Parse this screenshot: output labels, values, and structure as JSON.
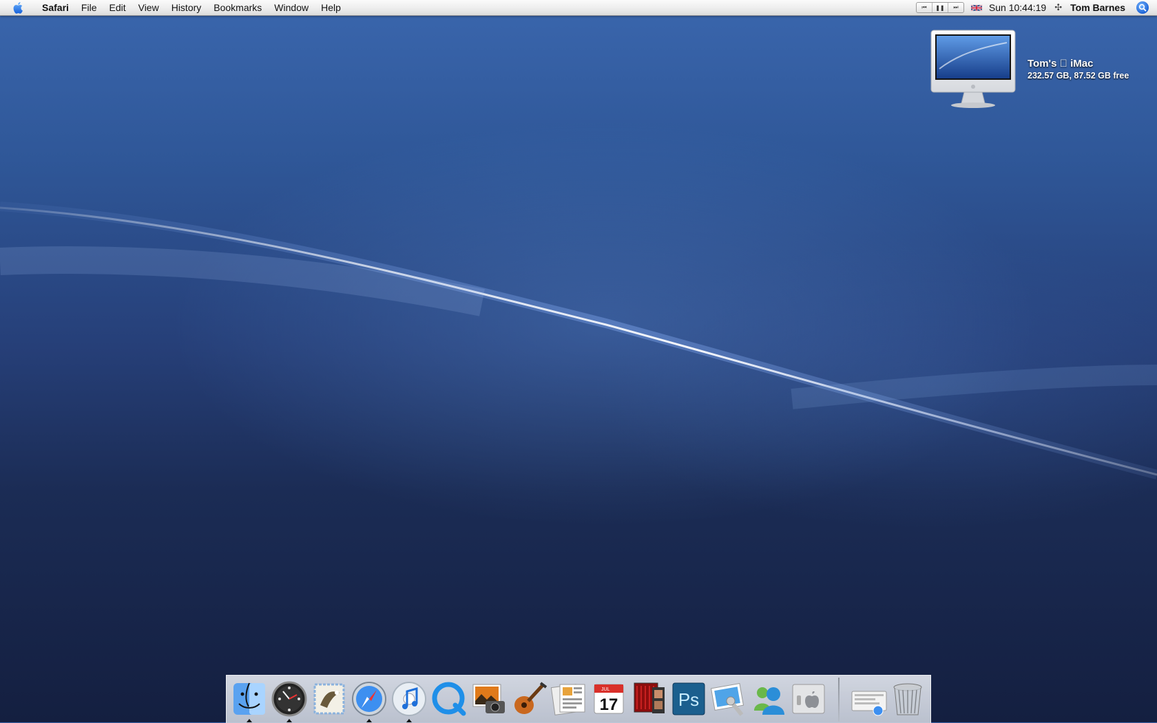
{
  "menubar": {
    "apple_icon": "apple-icon",
    "app_name": "Safari",
    "menus": [
      "File",
      "Edit",
      "View",
      "History",
      "Bookmarks",
      "Window",
      "Help"
    ],
    "media_controls": [
      "previous-track-icon",
      "pause-icon",
      "next-track-icon"
    ],
    "input_flag": "uk-flag-icon",
    "clock": "Sun 10:44:19",
    "network_icon": "network-icon",
    "user": "Tom Barnes",
    "spotlight_icon": "spotlight-search-icon"
  },
  "desktop": {
    "volume": {
      "name_prefix": "Tom's",
      "name_suffix": "iMac",
      "info": "232.57 GB, 87.52 GB free"
    }
  },
  "dock": {
    "items": [
      {
        "name": "finder-icon",
        "running": true
      },
      {
        "name": "dashboard-icon",
        "running": true
      },
      {
        "name": "mail-icon",
        "running": false
      },
      {
        "name": "safari-icon",
        "running": true
      },
      {
        "name": "itunes-icon",
        "running": true
      },
      {
        "name": "quicktime-icon",
        "running": false
      },
      {
        "name": "iphoto-icon",
        "running": false
      },
      {
        "name": "garageband-icon",
        "running": false
      },
      {
        "name": "pages-icon",
        "running": false
      },
      {
        "name": "ical-icon",
        "running": false,
        "calendar_month": "JUL",
        "calendar_day": "17"
      },
      {
        "name": "front-row-icon",
        "running": false
      },
      {
        "name": "photoshop-icon",
        "running": false,
        "label": "Ps"
      },
      {
        "name": "preview-icon",
        "running": false
      },
      {
        "name": "messenger-icon",
        "running": false
      },
      {
        "name": "system-preferences-icon",
        "running": false
      }
    ],
    "right_items": [
      {
        "name": "downloads-stack-icon"
      },
      {
        "name": "trash-icon"
      }
    ]
  },
  "colors": {
    "menubar_top": "#fbfbfb",
    "desktop_top": "#3a66ad",
    "desktop_bottom": "#141f40",
    "spotlight_blue": "#1c63d6"
  }
}
